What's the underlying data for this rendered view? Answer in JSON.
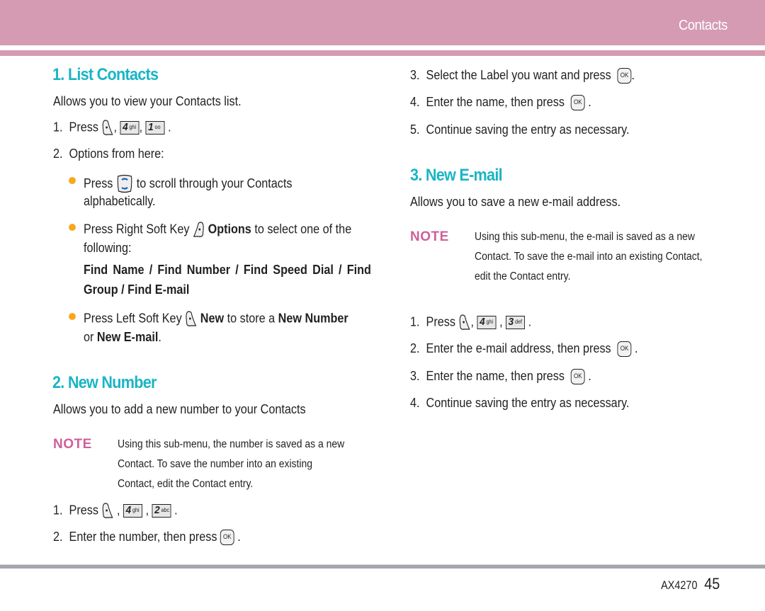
{
  "header": {
    "section": "Contacts"
  },
  "footer": {
    "model": "AX4270",
    "page": "45"
  },
  "colors": {
    "header_pink": "#d49bb2",
    "heading_teal": "#1ab5c5",
    "note_pink": "#cf5f9b",
    "bullet_orange": "#f7a81b"
  },
  "left": {
    "s1": {
      "title": "1. List Contacts",
      "desc": "Allows you to view your Contacts list.",
      "step1_num": "1.",
      "step1_text": "Press",
      "key_4": "4",
      "key_4_sub": "ghi",
      "key_1": "1",
      "key_1_sub": "oo",
      "step2_num": "2.",
      "step2_text": "Options from here:",
      "b1_a": "Press",
      "b1_b": "to scroll through your Contacts",
      "b1_c": "alphabetically.",
      "b2_a": "Press Right Soft Key",
      "b2_bold": "Options",
      "b2_b": "to select one of the",
      "b2_c": "following:",
      "find_line1": "Find Name / Find Number / Find Speed Dial / Find",
      "find_line2": "Group / Find E-mail",
      "b3_a": "Press Left Soft Key",
      "b3_bold1": "New",
      "b3_b": "to store a",
      "b3_bold2": "New Number",
      "b3_c": "or",
      "b3_bold3": "New E-mail",
      "b3_d": "."
    },
    "s2": {
      "title": "2. New Number",
      "desc": "Allows you to add a new number to your Contacts",
      "note_label": "NOTE",
      "note_l1": "Using this sub-menu, the number is saved as a new",
      "note_l2": "Contact. To save the number into an existing",
      "note_l3": "Contact, edit the Contact entry.",
      "step1_num": "1.",
      "step1_text": "Press",
      "key_4": "4",
      "key_4_sub": "ghi",
      "key_2": "2",
      "key_2_sub": "abc",
      "step2_num": "2.",
      "step2_text": "Enter the number, then press",
      "ok": "OK"
    }
  },
  "right": {
    "cont": {
      "s3_num": "3.",
      "s3_text": "Select the Label you want and press",
      "s4_num": "4.",
      "s4_text": "Enter the name, then press",
      "s5_num": "5.",
      "s5_text": "Continue saving the entry as necessary.",
      "ok": "OK"
    },
    "s3": {
      "title": "3. New E-mail",
      "desc": "Allows you to save a new e-mail address.",
      "note_label": "NOTE",
      "note_l1": "Using this sub-menu, the e-mail is saved as a new",
      "note_l2": "Contact. To save the e-mail into an existing Contact,",
      "note_l3": "edit the Contact entry.",
      "step1_num": "1.",
      "step1_text": "Press",
      "key_4": "4",
      "key_4_sub": "ghi",
      "key_3": "3",
      "key_3_sub": "def",
      "step2_num": "2.",
      "step2_text": "Enter the e-mail address, then press",
      "step3_num": "3.",
      "step3_text": "Enter the name, then press",
      "step4_num": "4.",
      "step4_text": "Continue saving the entry as necessary.",
      "ok": "OK"
    }
  }
}
